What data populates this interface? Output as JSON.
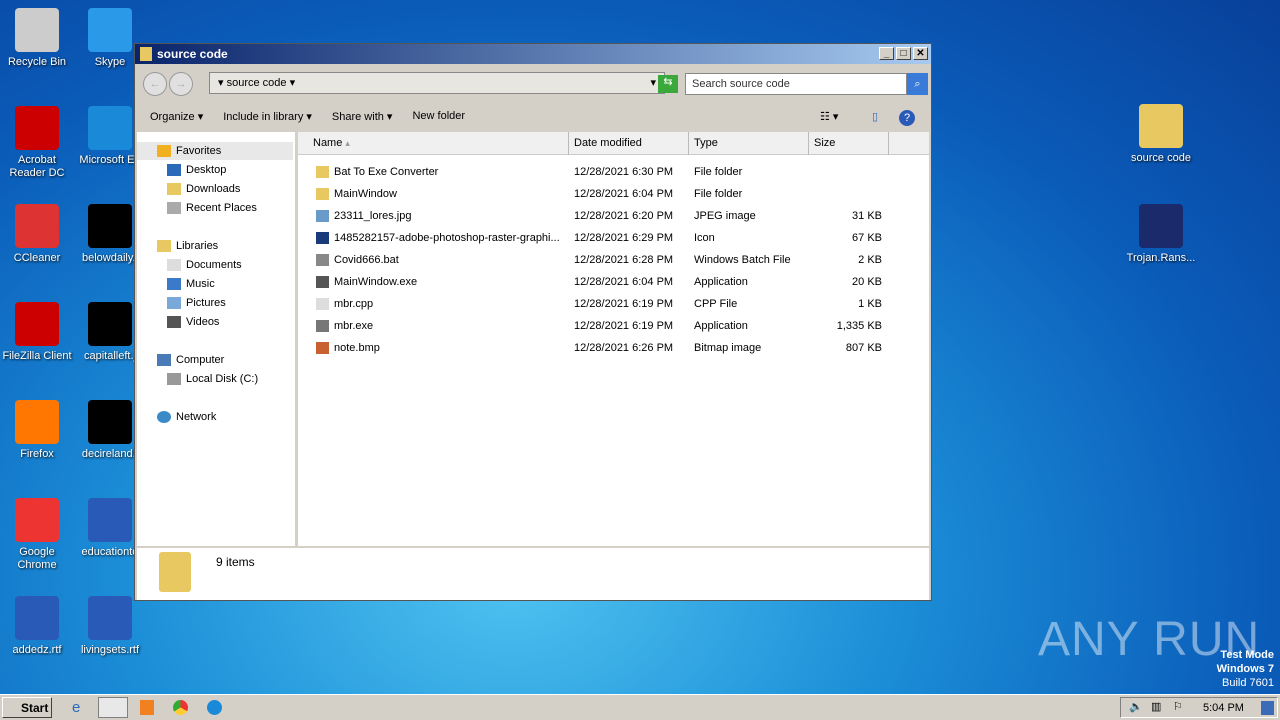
{
  "desktop": {
    "left": [
      "Recycle Bin",
      "Skype",
      "Acrobat Reader DC",
      "Microsoft Ed",
      "CCleaner",
      "belowdaily.j",
      "FileZilla Client",
      "capitalleft.j",
      "Firefox",
      "decireland.j",
      "Google Chrome",
      "educationto",
      "addedz.rtf",
      "livingsets.rtf"
    ],
    "right": [
      "source code",
      "Trojan.Rans..."
    ]
  },
  "window": {
    "title": "source code",
    "address": "source code",
    "search_placeholder": "Search source code",
    "toolbar": [
      "Organize",
      "Include in library",
      "Share with",
      "New folder"
    ],
    "nav": {
      "favorites": "Favorites",
      "desktop": "Desktop",
      "downloads": "Downloads",
      "recent": "Recent Places",
      "libraries": "Libraries",
      "documents": "Documents",
      "music": "Music",
      "pictures": "Pictures",
      "videos": "Videos",
      "computer": "Computer",
      "localdisk": "Local Disk (C:)",
      "network": "Network"
    },
    "columns": [
      "Name",
      "Date modified",
      "Type",
      "Size"
    ],
    "files": [
      {
        "name": "Bat To Exe Converter",
        "date": "12/28/2021 6:30 PM",
        "type": "File folder",
        "size": "",
        "color": "#e8c860"
      },
      {
        "name": "MainWindow",
        "date": "12/28/2021 6:04 PM",
        "type": "File folder",
        "size": "",
        "color": "#e8c860"
      },
      {
        "name": "23311_lores.jpg",
        "date": "12/28/2021 6:20 PM",
        "type": "JPEG image",
        "size": "31 KB",
        "color": "#6a9ac8"
      },
      {
        "name": "1485282157-adobe-photoshop-raster-graphi...",
        "date": "12/28/2021 6:29 PM",
        "type": "Icon",
        "size": "67 KB",
        "color": "#1a3a7a"
      },
      {
        "name": "Covid666.bat",
        "date": "12/28/2021 6:28 PM",
        "type": "Windows Batch File",
        "size": "2 KB",
        "color": "#888"
      },
      {
        "name": "MainWindow.exe",
        "date": "12/28/2021 6:04 PM",
        "type": "Application",
        "size": "20 KB",
        "color": "#555"
      },
      {
        "name": "mbr.cpp",
        "date": "12/28/2021 6:19 PM",
        "type": "CPP File",
        "size": "1 KB",
        "color": "#ddd"
      },
      {
        "name": "mbr.exe",
        "date": "12/28/2021 6:19 PM",
        "type": "Application",
        "size": "1,335 KB",
        "color": "#777"
      },
      {
        "name": "note.bmp",
        "date": "12/28/2021 6:26 PM",
        "type": "Bitmap image",
        "size": "807 KB",
        "color": "#c86030"
      }
    ],
    "status": "9 items"
  },
  "watermark": {
    "logo": "ANY RUN",
    "line1": "Test Mode",
    "line2": "Windows 7",
    "line3": "Build 7601"
  },
  "taskbar": {
    "start": "Start",
    "clock": "5:04 PM"
  }
}
